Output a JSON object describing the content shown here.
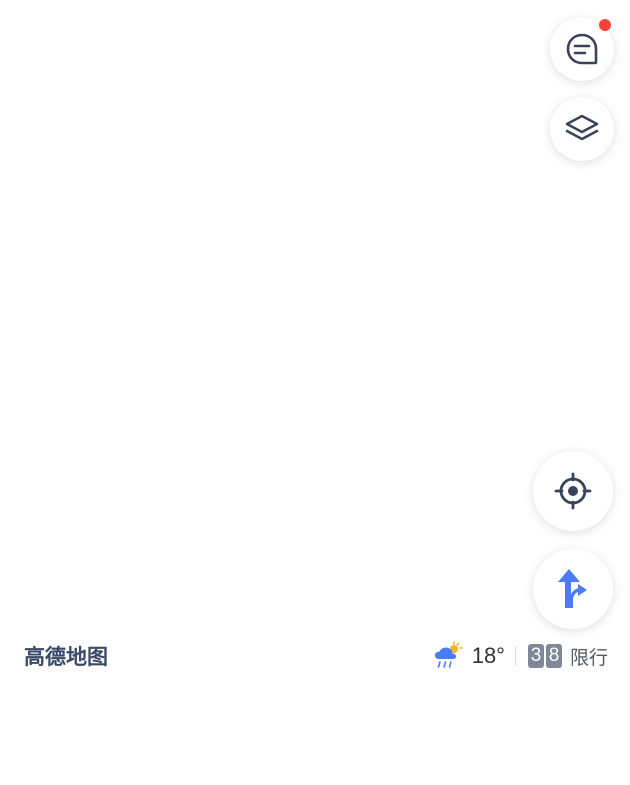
{
  "brand": {
    "logo_text": "高德地图"
  },
  "controls": {
    "message": {
      "icon": "message-icon",
      "has_notification": true
    },
    "layers": {
      "icon": "layers-icon"
    },
    "locate": {
      "icon": "locate-icon"
    },
    "navigate": {
      "icon": "route-arrow-icon"
    }
  },
  "status_bar": {
    "weather_icon": "rain-sun-icon",
    "temperature": "18°",
    "restriction_digits": [
      "3",
      "8"
    ],
    "restriction_label": "限行"
  },
  "colors": {
    "accent_blue": "#4a7cf7",
    "notification_red": "#f5433c",
    "icon_dark": "#3b4257",
    "plate_gray": "#7f8799"
  }
}
